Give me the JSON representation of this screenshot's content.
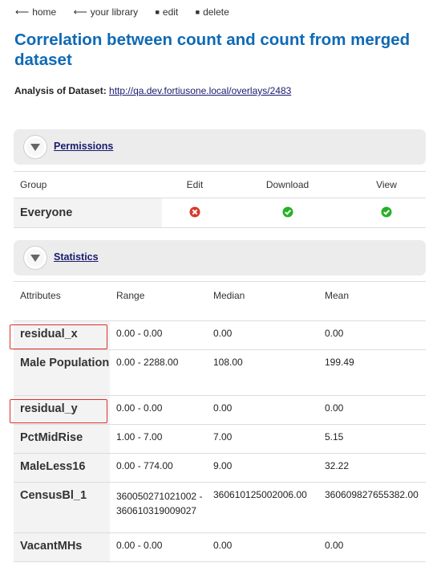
{
  "nav": {
    "home": "home",
    "library": "your library",
    "edit": "edit",
    "delete": "delete"
  },
  "title": "Correlation between count and count from merged dataset",
  "analysis": {
    "label": "Analysis of Dataset:",
    "link": "http://qa.dev.fortiusone.local/overlays/2483"
  },
  "permissions": {
    "panel_label": "Permissions",
    "columns": [
      "Group",
      "Edit",
      "Download",
      "View"
    ],
    "rows": [
      {
        "group": "Everyone",
        "edit": "denied",
        "download": "allowed",
        "view": "allowed"
      }
    ]
  },
  "statistics": {
    "panel_label": "Statistics",
    "columns": [
      "Attributes",
      "Range",
      "Median",
      "Mean"
    ],
    "rows": [
      {
        "attr": "residual_x",
        "range": "0.00 - 0.00",
        "median": "0.00",
        "mean": "0.00"
      },
      {
        "attr": "Male Population",
        "range": "0.00 - 2288.00",
        "median": "108.00",
        "mean": "199.49"
      },
      {
        "attr": "residual_y",
        "range": "0.00 - 0.00",
        "median": "0.00",
        "mean": "0.00"
      },
      {
        "attr": "PctMidRise",
        "range": "1.00 - 7.00",
        "median": "7.00",
        "mean": "5.15"
      },
      {
        "attr": "MaleLess16",
        "range": "0.00 - 774.00",
        "median": "9.00",
        "mean": "32.22"
      },
      {
        "attr": "CensusBl_1",
        "range": "360050271021002 - 360610319009027",
        "median": "360610125002006.00",
        "mean": "360609827655382.00"
      },
      {
        "attr": "VacantMHs",
        "range": "0.00 - 0.00",
        "median": "0.00",
        "mean": "0.00"
      }
    ]
  },
  "colors": {
    "title": "#0e6ab5",
    "panel": "#ececec",
    "allowed": "#27b026",
    "denied": "#d43a2a",
    "highlight": "#e03030"
  }
}
